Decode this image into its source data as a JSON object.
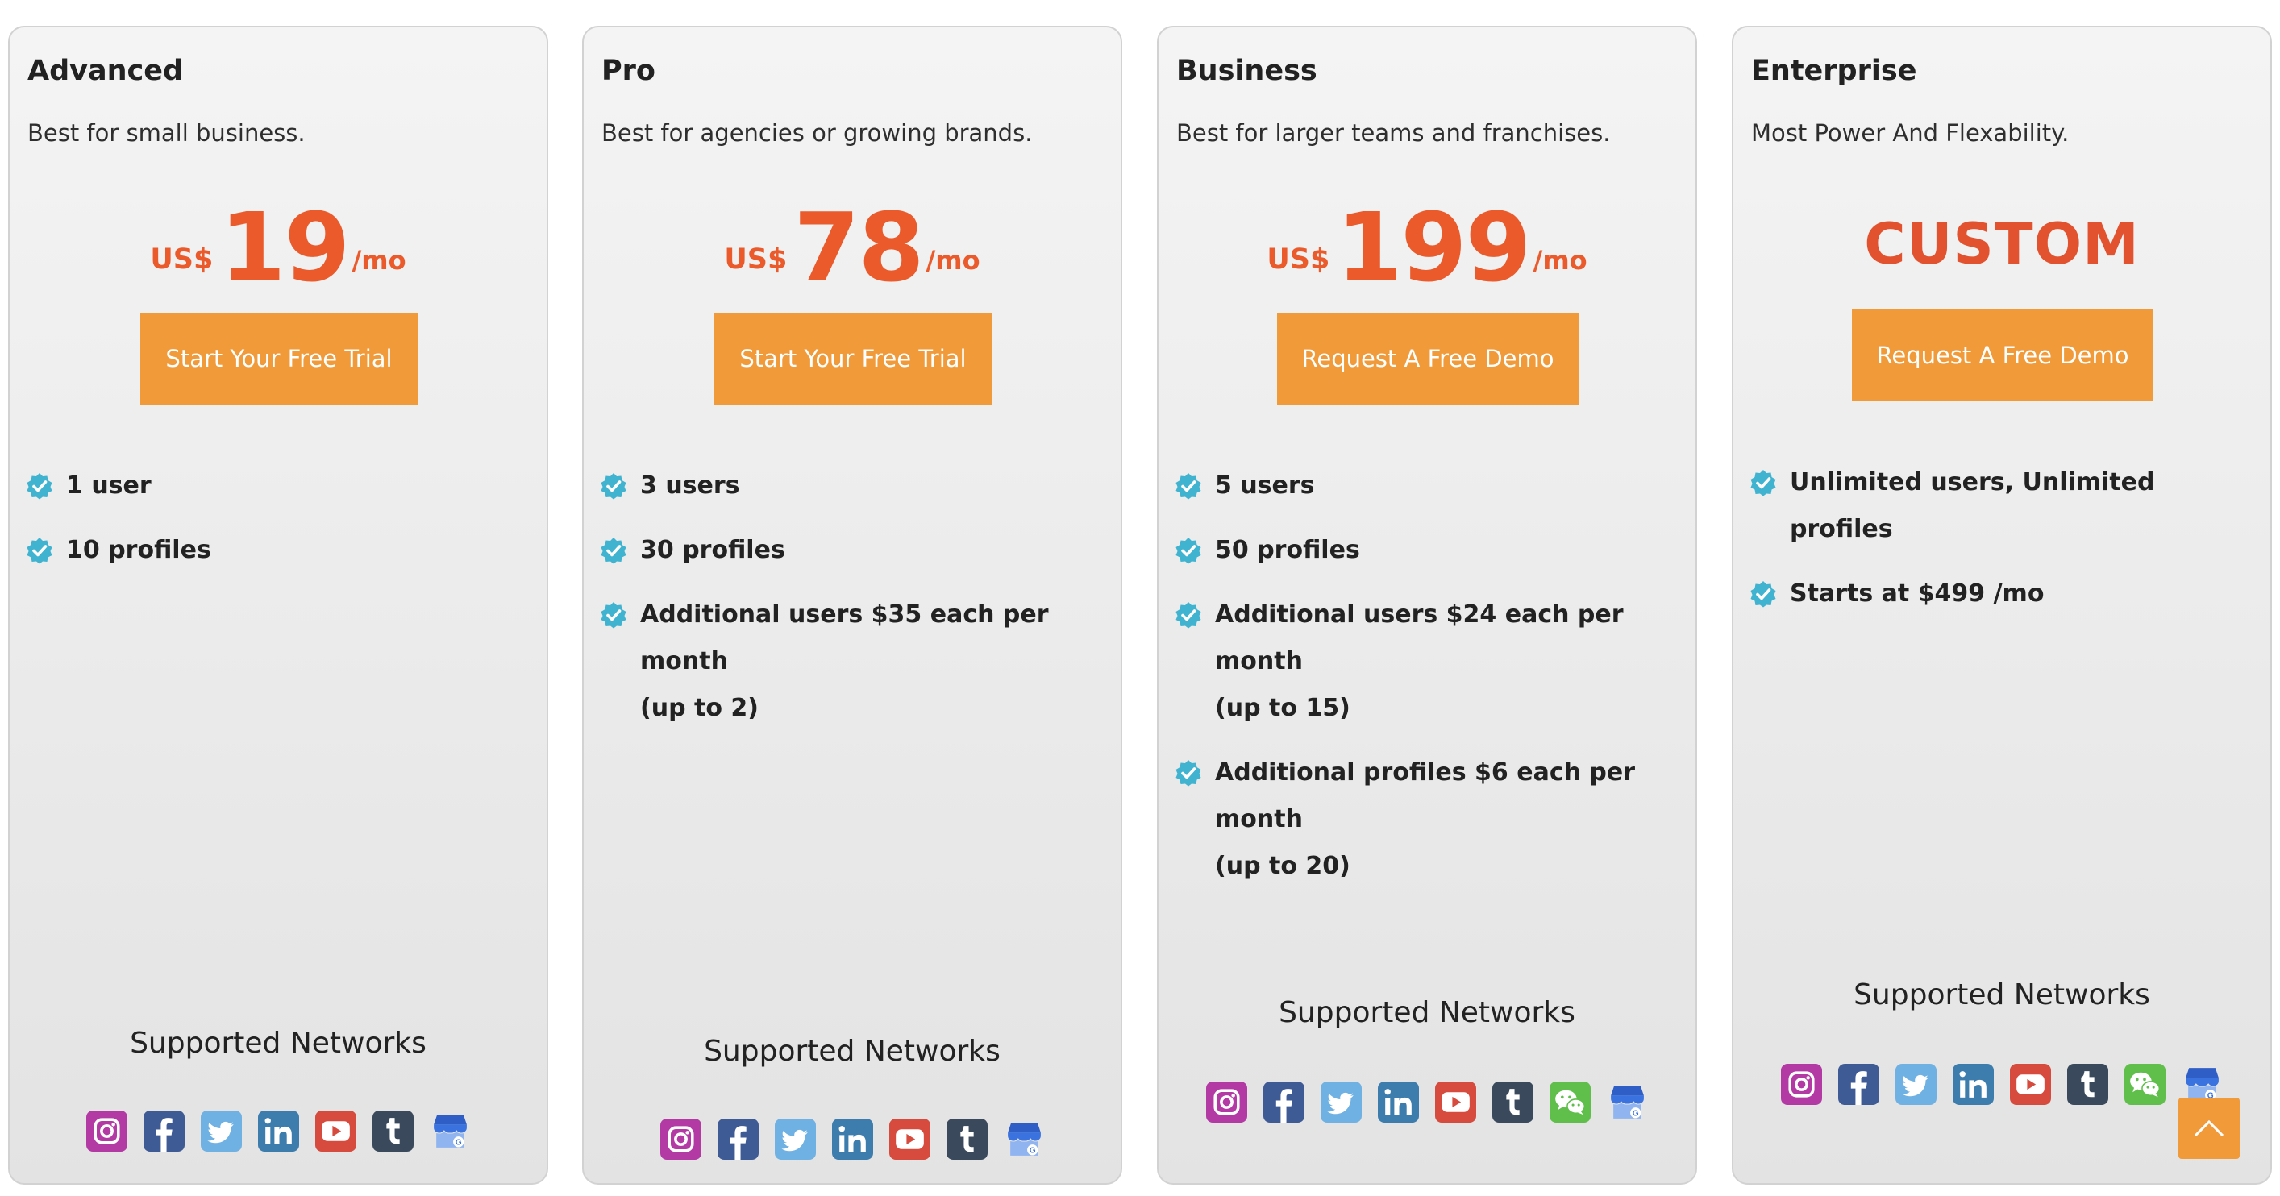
{
  "section": {
    "label": "Supported Networks"
  },
  "plans": [
    {
      "name": "Advanced",
      "description": "Best for small business.",
      "price": {
        "currency": "US$",
        "amount": "19",
        "period": "/mo"
      },
      "cta": "Start Your Free Trial",
      "features": [
        "1 user",
        "10 profiles"
      ],
      "networks": [
        "instagram-icon",
        "facebook-icon",
        "twitter-icon",
        "linkedin-icon",
        "youtube-icon",
        "tumblr-icon",
        "google-business-icon"
      ]
    },
    {
      "name": "Pro",
      "description": "Best for agencies or growing brands.",
      "price": {
        "currency": "US$",
        "amount": "78",
        "period": "/mo"
      },
      "cta": "Start Your Free Trial",
      "features": [
        "3 users",
        "30 profiles",
        "Additional users $35 each per month",
        "(up to 2)"
      ],
      "networks": [
        "instagram-icon",
        "facebook-icon",
        "twitter-icon",
        "linkedin-icon",
        "youtube-icon",
        "tumblr-icon",
        "google-business-icon"
      ]
    },
    {
      "name": "Business",
      "description": "Best for larger teams and franchises.",
      "price": {
        "currency": "US$",
        "amount": "199",
        "period": "/mo"
      },
      "cta": "Request A Free Demo",
      "features": [
        "5 users",
        "50 profiles",
        "Additional users $24 each per month",
        "(up to 15)",
        "Additional profiles $6 each per month",
        "(up to 20)"
      ],
      "networks": [
        "instagram-icon",
        "facebook-icon",
        "twitter-icon",
        "linkedin-icon",
        "youtube-icon",
        "tumblr-icon",
        "wechat-icon",
        "google-business-icon"
      ]
    },
    {
      "name": "Enterprise",
      "description": "Most Power And Flexability.",
      "price": {
        "custom": "CUSTOM"
      },
      "cta": "Request A Free Demo",
      "features": [
        "Unlimited users, Unlimited profiles",
        "Starts at $499 /mo"
      ],
      "networks": [
        "instagram-icon",
        "facebook-icon",
        "twitter-icon",
        "linkedin-icon",
        "youtube-icon",
        "tumblr-icon",
        "wechat-icon",
        "google-business-icon"
      ]
    }
  ],
  "colors": {
    "accent": "#f19a3a",
    "price": "#ea5a2a",
    "check": "#3fb3cf",
    "card_border": "#d2d2d2"
  }
}
